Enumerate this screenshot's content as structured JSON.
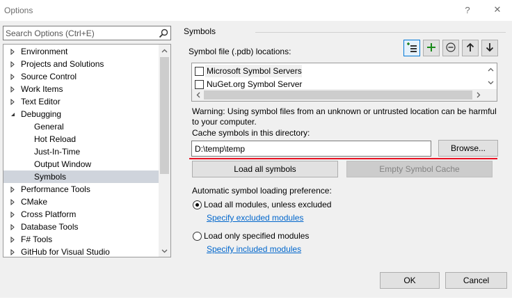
{
  "window": {
    "title": "Options",
    "help_glyph": "?",
    "close_glyph": "✕"
  },
  "search": {
    "placeholder": "Search Options (Ctrl+E)",
    "icon": "search-icon"
  },
  "tree": {
    "items": [
      {
        "label": "Environment",
        "level": 0,
        "state": "collapsed"
      },
      {
        "label": "Projects and Solutions",
        "level": 0,
        "state": "collapsed"
      },
      {
        "label": "Source Control",
        "level": 0,
        "state": "collapsed"
      },
      {
        "label": "Work Items",
        "level": 0,
        "state": "collapsed"
      },
      {
        "label": "Text Editor",
        "level": 0,
        "state": "collapsed"
      },
      {
        "label": "Debugging",
        "level": 0,
        "state": "expanded"
      },
      {
        "label": "General",
        "level": 1,
        "state": "leaf"
      },
      {
        "label": "Hot Reload",
        "level": 1,
        "state": "leaf"
      },
      {
        "label": "Just-In-Time",
        "level": 1,
        "state": "leaf"
      },
      {
        "label": "Output Window",
        "level": 1,
        "state": "leaf"
      },
      {
        "label": "Symbols",
        "level": 1,
        "state": "leaf",
        "selected": true
      },
      {
        "label": "Performance Tools",
        "level": 0,
        "state": "collapsed"
      },
      {
        "label": "CMake",
        "level": 0,
        "state": "collapsed"
      },
      {
        "label": "Cross Platform",
        "level": 0,
        "state": "collapsed"
      },
      {
        "label": "Database Tools",
        "level": 0,
        "state": "collapsed"
      },
      {
        "label": "F# Tools",
        "level": 0,
        "state": "collapsed"
      },
      {
        "label": "GitHub for Visual Studio",
        "level": 0,
        "state": "collapsed"
      }
    ]
  },
  "panel": {
    "section_title": "Symbols",
    "locations_label": "Symbol file (.pdb) locations:",
    "toolbar": [
      "new-location-icon",
      "add-icon",
      "remove-icon",
      "move-up-icon",
      "move-down-icon"
    ],
    "locations": [
      {
        "label": "Microsoft Symbol Servers",
        "checked": false
      },
      {
        "label": "NuGet.org Symbol Server",
        "checked": false
      }
    ],
    "warning_line1": "Warning: Using symbol files from an unknown or untrusted location can be harmful",
    "warning_line2": "to your computer.",
    "cache_label": "Cache symbols in this directory:",
    "cache_path": "D:\\temp\\temp",
    "browse_label": "Browse...",
    "load_all_label": "Load all symbols",
    "empty_cache_label": "Empty Symbol Cache",
    "auto_label": "Automatic symbol loading preference:",
    "option_all": "Load all modules, unless excluded",
    "link_excluded": "Specify excluded modules",
    "option_specified": "Load only specified modules",
    "link_included": "Specify included modules",
    "selected_option": "all"
  },
  "footer": {
    "ok_label": "OK",
    "cancel_label": "Cancel"
  }
}
